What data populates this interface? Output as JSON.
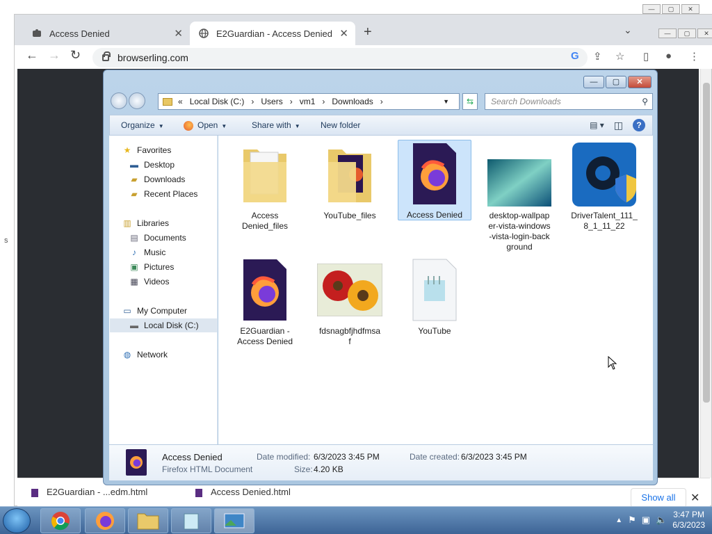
{
  "window_controls": {
    "min": "—",
    "max": "▢",
    "close": "✕"
  },
  "left_strip_char": "s",
  "chrome": {
    "tabs": [
      {
        "title": "Access Denied",
        "icon": "puzzle-icon"
      },
      {
        "title": "E2Guardian - Access Denied",
        "icon": "globe-icon"
      }
    ],
    "url": "browserling.com",
    "downloads": [
      {
        "label": "E2Guardian - ...edm.html"
      },
      {
        "label": "Access Denied.html"
      }
    ],
    "show_all": "Show all"
  },
  "explorer": {
    "breadcrumb": {
      "prefix": "«",
      "parts": [
        "Local Disk (C:)",
        "Users",
        "vm1",
        "Downloads"
      ]
    },
    "search_placeholder": "Search Downloads",
    "commands": {
      "organize": "Organize",
      "open": "Open",
      "share": "Share with",
      "new_folder": "New folder"
    },
    "nav": {
      "favorites": "Favorites",
      "desktop": "Desktop",
      "downloads": "Downloads",
      "recent": "Recent Places",
      "libraries": "Libraries",
      "documents": "Documents",
      "music": "Music",
      "pictures": "Pictures",
      "videos": "Videos",
      "computer": "My Computer",
      "local_disk": "Local Disk (C:)",
      "network": "Network"
    },
    "items": [
      {
        "line1": "Access",
        "line2": "Denied_files",
        "line3": "",
        "line4": "",
        "kind": "folder"
      },
      {
        "line1": "YouTube_files",
        "line2": "",
        "line3": "",
        "line4": "",
        "kind": "folder"
      },
      {
        "line1": "Access Denied",
        "line2": "",
        "line3": "",
        "line4": "",
        "kind": "firefox",
        "selected": true
      },
      {
        "line1": "desktop-wallpap",
        "line2": "er-vista-windows",
        "line3": "-vista-login-back",
        "line4": "ground",
        "kind": "image"
      },
      {
        "line1": "DriverTalent_111_",
        "line2": "8_1_11_22",
        "line3": "",
        "line4": "",
        "kind": "app"
      },
      {
        "line1": "E2Guardian -",
        "line2": "Access Denied",
        "line3": "",
        "line4": "",
        "kind": "firefox"
      },
      {
        "line1": "fdsnagbfjhdfmsa",
        "line2": "f",
        "line3": "",
        "line4": "",
        "kind": "flowers"
      },
      {
        "line1": "YouTube",
        "line2": "",
        "line3": "",
        "line4": "",
        "kind": "notepad"
      }
    ],
    "details": {
      "name": "Access Denied",
      "type": "Firefox HTML Document",
      "modified_label": "Date modified:",
      "modified": "6/3/2023 3:45 PM",
      "created_label": "Date created:",
      "created": "6/3/2023 3:45 PM",
      "size_label": "Size:",
      "size": "4.20 KB"
    }
  },
  "taskbar": {
    "time": "3:47 PM",
    "date": "6/3/2023"
  }
}
